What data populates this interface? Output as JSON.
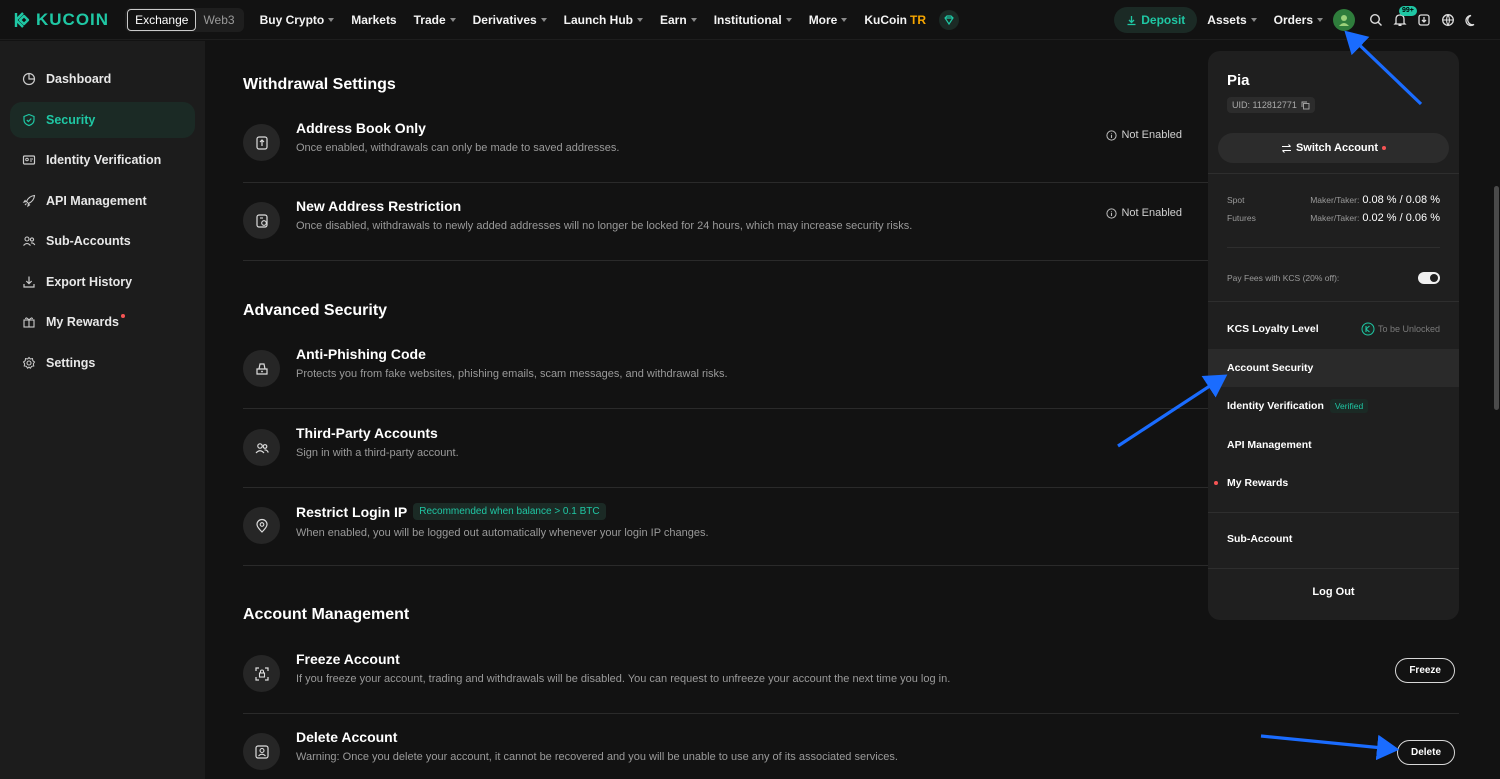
{
  "topnav": {
    "logo_text": "KUCOIN",
    "segment": [
      "Exchange",
      "Web3"
    ],
    "menu": [
      {
        "label": "Buy Crypto",
        "caret": true
      },
      {
        "label": "Markets",
        "caret": false
      },
      {
        "label": "Trade",
        "caret": true
      },
      {
        "label": "Derivatives",
        "caret": true
      },
      {
        "label": "Launch Hub",
        "caret": true
      },
      {
        "label": "Earn",
        "caret": true
      },
      {
        "label": "Institutional",
        "caret": true
      },
      {
        "label": "More",
        "caret": true
      }
    ],
    "kucoin_tr": {
      "label": "KuCoin",
      "suffix": "TR"
    },
    "deposit_label": "Deposit",
    "assets_label": "Assets",
    "orders_label": "Orders",
    "notification_badge": "99+",
    "accent_color": "#1fc7a4"
  },
  "sidebar": {
    "items": [
      {
        "label": "Dashboard",
        "icon": "pie-chart-icon"
      },
      {
        "label": "Security",
        "icon": "shield-icon",
        "active": true
      },
      {
        "label": "Identity Verification",
        "icon": "id-card-icon"
      },
      {
        "label": "API Management",
        "icon": "rocket-icon"
      },
      {
        "label": "Sub-Accounts",
        "icon": "users-icon"
      },
      {
        "label": "Export History",
        "icon": "download-icon"
      },
      {
        "label": "My Rewards",
        "icon": "gift-icon",
        "dot": true
      },
      {
        "label": "Settings",
        "icon": "gear-icon"
      }
    ]
  },
  "main": {
    "withdrawal": {
      "title": "Withdrawal Settings",
      "rows": [
        {
          "title": "Address Book Only",
          "desc": "Once enabled, withdrawals can only be made to saved addresses.",
          "status": "Not Enabled"
        },
        {
          "title": "New Address Restriction",
          "desc": "Once disabled, withdrawals to newly added addresses will no longer be locked for 24 hours, which may increase security risks.",
          "status": "Not Enabled"
        }
      ]
    },
    "advanced": {
      "title": "Advanced Security",
      "rows": [
        {
          "title": "Anti-Phishing Code",
          "desc": "Protects you from fake websites, phishing emails, scam messages, and withdrawal risks."
        },
        {
          "title": "Third-Party Accounts",
          "desc": "Sign in with a third-party account."
        },
        {
          "title": "Restrict Login IP",
          "tag": "Recommended when balance > 0.1 BTC",
          "desc": "When enabled, you will be logged out automatically whenever your login IP changes."
        }
      ]
    },
    "account_mgmt": {
      "title": "Account Management",
      "rows": [
        {
          "title": "Freeze Account",
          "desc": "If you freeze your account, trading and withdrawals will be disabled. You can request to unfreeze your account the next time you log in.",
          "button": "Freeze"
        },
        {
          "title": "Delete Account",
          "desc": "Warning: Once you delete your account, it cannot be recovered and you will be unable to use any of its associated services.",
          "button": "Delete"
        }
      ]
    }
  },
  "dropdown": {
    "name": "Pia",
    "uid": "UID: 112812771",
    "switch_label": "Switch Account",
    "spot": {
      "label": "Spot",
      "mt": "Maker/Taker:",
      "value": "0.08 % / 0.08 %"
    },
    "futures": {
      "label": "Futures",
      "mt": "Maker/Taker:",
      "value": "0.02 % / 0.06 %"
    },
    "kcs_fee_label": "Pay Fees with KCS (20% off):",
    "kcs_fee_on": true,
    "loyalty": {
      "label": "KCS Loyalty Level",
      "status": "To be Unlocked"
    },
    "items": [
      {
        "label": "Account Security"
      },
      {
        "label": "Identity Verification",
        "tag": "Verified"
      },
      {
        "label": "API Management"
      },
      {
        "label": "My Rewards"
      }
    ],
    "sub_account": "Sub-Account",
    "logout": "Log Out"
  }
}
